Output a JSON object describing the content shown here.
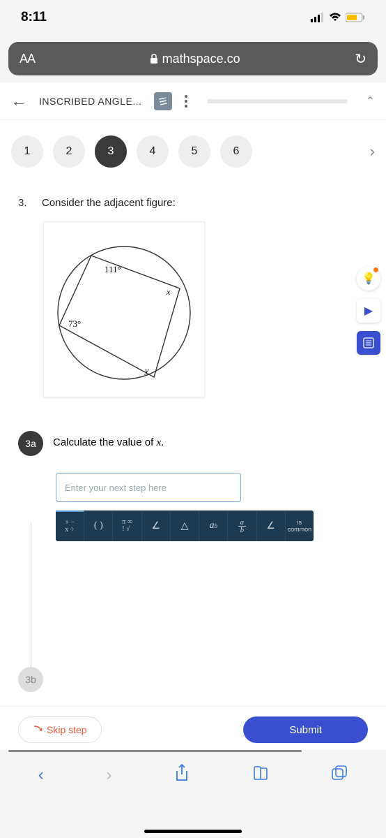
{
  "status": {
    "time": "8:11"
  },
  "address": {
    "aa": "AA",
    "url": "mathspace.co"
  },
  "header": {
    "title": "INSCRIBED ANGLE..."
  },
  "steps": {
    "items": [
      "1",
      "2",
      "3",
      "4",
      "5",
      "6"
    ],
    "activeIndex": 2
  },
  "question": {
    "number": "3.",
    "prompt": "Consider the adjacent figure:",
    "angle1": "111°",
    "angle2": "73°",
    "labelX": "x",
    "labelY": "y"
  },
  "subpart_a": {
    "label": "3a",
    "text_prefix": "Calculate the value of ",
    "variable": "x",
    "text_suffix": "."
  },
  "subpart_b": {
    "label": "3b"
  },
  "input": {
    "placeholder": "Enter your next step here"
  },
  "toolbar": {
    "ops": "+ −\nx ÷",
    "paren": "( )",
    "pi": "π ∞\n! √",
    "angle": "∠",
    "triangle": "△",
    "power": "aᵇ",
    "frac": "a/b",
    "angle2": "∠",
    "common_top": "is",
    "common_bottom": "common"
  },
  "actions": {
    "skip": "Skip step",
    "submit": "Submit"
  }
}
